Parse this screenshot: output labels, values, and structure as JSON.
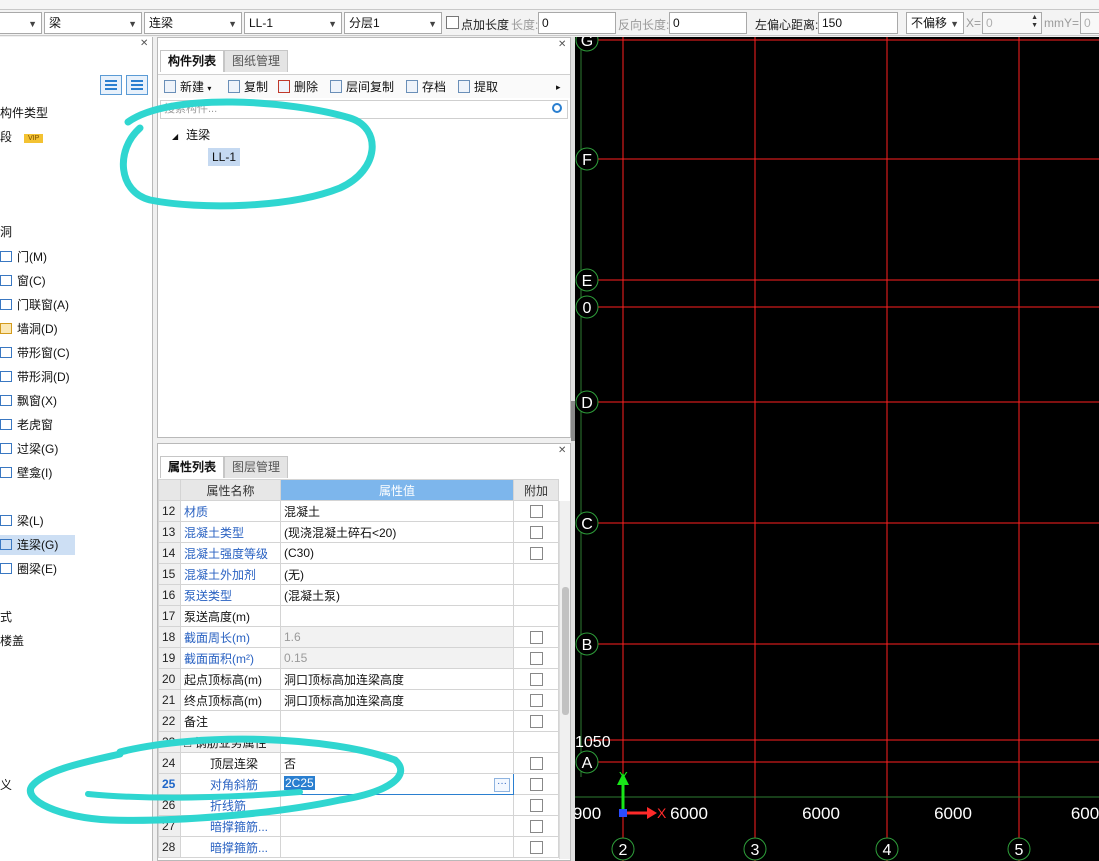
{
  "toolbar": {
    "combo_floor_type": "梁",
    "combo_component_type": "连梁",
    "combo_component": "LL-1",
    "combo_layer": "分层1",
    "point_length_label": "点加长度",
    "length_label": "长度:",
    "length_value": "0",
    "reverse_length_label": "反向长度:",
    "reverse_length_value": "0",
    "left_offset_label": "左偏心距离:",
    "left_offset_value": "150",
    "offset_mode": "不偏移",
    "x_label": "X=",
    "x_value": "0",
    "mm_y_label": "mmY=",
    "y_value": "0"
  },
  "left_panel": {
    "items": [
      {
        "label": "构件类型",
        "type": "text"
      },
      {
        "label": "段",
        "type": "vip",
        "badge": "VIP"
      },
      {
        "label": "洞",
        "type": "section"
      },
      {
        "label": "门(M)",
        "icon": "door-icon"
      },
      {
        "label": "窗(C)",
        "icon": "window-icon"
      },
      {
        "label": "门联窗(A)",
        "icon": "door-window-icon"
      },
      {
        "label": "墙洞(D)",
        "icon": "wall-hole-icon"
      },
      {
        "label": "带形窗(C)",
        "icon": "strip-window-icon"
      },
      {
        "label": "带形洞(D)",
        "icon": "strip-hole-icon"
      },
      {
        "label": "飘窗(X)",
        "icon": "bay-window-icon"
      },
      {
        "label": "老虎窗",
        "icon": "dormer-window-icon"
      },
      {
        "label": "过梁(G)",
        "icon": "lintel-icon"
      },
      {
        "label": "壁龛(I)",
        "icon": "niche-icon"
      },
      {
        "label": "梁(L)",
        "icon": "beam-icon"
      },
      {
        "label": "连梁(G)",
        "icon": "coupling-beam-icon",
        "selected": true
      },
      {
        "label": "圈梁(E)",
        "icon": "ring-beam-icon"
      },
      {
        "label": "式",
        "type": "text"
      },
      {
        "label": "楼盖",
        "type": "text"
      },
      {
        "label": "义",
        "type": "text"
      }
    ]
  },
  "component_panel": {
    "tabs": [
      "构件列表",
      "图纸管理"
    ],
    "actions": [
      "新建",
      "复制",
      "删除",
      "层间复制",
      "存档",
      "提取"
    ],
    "search_placeholder": "搜索构件...",
    "tree_root": "连梁",
    "tree_child": "LL-1"
  },
  "property_panel": {
    "tabs": [
      "属性列表",
      "图层管理"
    ],
    "headers": {
      "name": "属性名称",
      "value": "属性值",
      "extra": "附加"
    },
    "rows": [
      {
        "num": "12",
        "name": "材质",
        "value": "混凝土",
        "blue": true,
        "check": true
      },
      {
        "num": "13",
        "name": "混凝土类型",
        "value": "(现浇混凝土碎石<20)",
        "blue": true,
        "check": true
      },
      {
        "num": "14",
        "name": "混凝土强度等级",
        "value": "(C30)",
        "blue": true,
        "check": true
      },
      {
        "num": "15",
        "name": "混凝土外加剂",
        "value": "(无)",
        "blue": true,
        "check": false
      },
      {
        "num": "16",
        "name": "泵送类型",
        "value": "(混凝土泵)",
        "blue": true,
        "check": false
      },
      {
        "num": "17",
        "name": "泵送高度(m)",
        "value": "",
        "blue": false,
        "check": false
      },
      {
        "num": "18",
        "name": "截面周长(m)",
        "value": "1.6",
        "blue": true,
        "gray": true,
        "check": true
      },
      {
        "num": "19",
        "name": "截面面积(m²)",
        "value": "0.15",
        "blue": true,
        "gray": true,
        "check": true
      },
      {
        "num": "20",
        "name": "起点顶标高(m)",
        "value": "洞口顶标高加连梁高度",
        "blue": false,
        "check": true
      },
      {
        "num": "21",
        "name": "终点顶标高(m)",
        "value": "洞口顶标高加连梁高度",
        "blue": false,
        "check": true
      },
      {
        "num": "22",
        "name": "备注",
        "value": "",
        "blue": false,
        "check": true
      },
      {
        "num": "23",
        "name": "□ 钢筋业务属性",
        "value": "",
        "blue": false,
        "group": true,
        "check": false
      },
      {
        "num": "24",
        "name": "顶层连梁",
        "value": "否",
        "blue": false,
        "indent": true,
        "check": true
      },
      {
        "num": "25",
        "name": "对角斜筋",
        "value": "2C25",
        "blue": true,
        "indent": true,
        "editing": true,
        "current": true,
        "check": true
      },
      {
        "num": "26",
        "name": "折线筋",
        "value": "",
        "blue": true,
        "indent": true,
        "check": true
      },
      {
        "num": "27",
        "name": "暗撑箍筋...",
        "value": "",
        "blue": true,
        "indent": true,
        "check": true
      },
      {
        "num": "28",
        "name": "暗撑箍筋...",
        "value": "",
        "blue": true,
        "indent": true,
        "check": true
      }
    ]
  },
  "canvas": {
    "background": "#000000",
    "grid_color": "#ff2020",
    "axis_labels_row": [
      "G",
      "F",
      "E",
      "0",
      "D",
      "C",
      "B",
      "A"
    ],
    "axis_labels_col": [
      "2",
      "3",
      "4",
      "5"
    ],
    "dimension_1050": "1050",
    "dimensions_bottom": [
      "900",
      "6000",
      "6000",
      "6000",
      "600"
    ],
    "ucs_x_label": "X",
    "ucs_y_label": "Y"
  },
  "colors": {
    "accent": "#2a7fd0",
    "annotation": "#2fd6d0",
    "header_blue": "#7db6ec"
  }
}
